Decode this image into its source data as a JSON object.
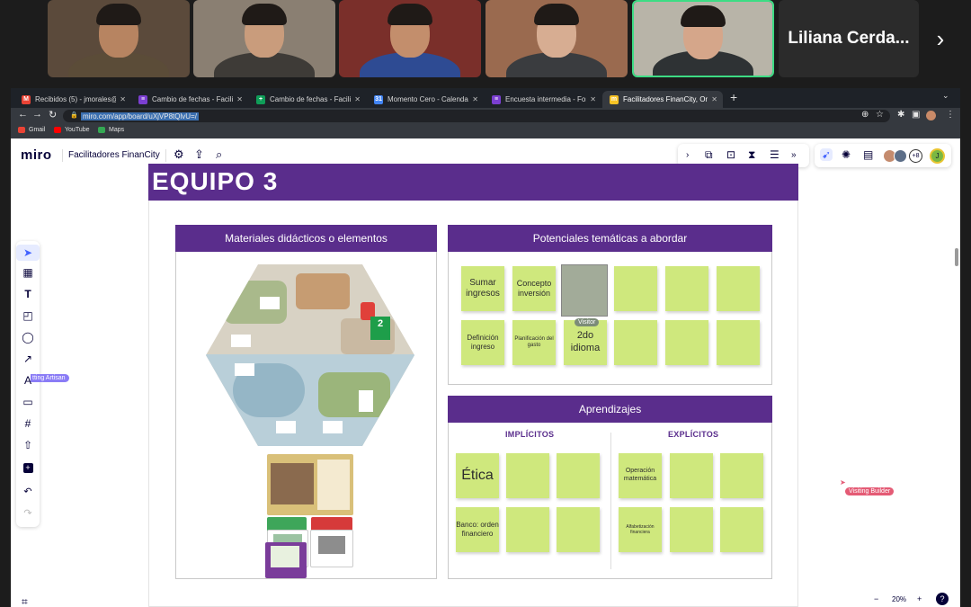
{
  "meeting": {
    "participants": [
      {
        "bg": "#5b4a3b",
        "skin": "#b78461",
        "shirt": "#5b4c38"
      },
      {
        "bg": "#8a7f72",
        "skin": "#c99c7c",
        "shirt": "#3e3b37"
      },
      {
        "bg": "#7a2f2a",
        "skin": "#c38e6c",
        "shirt": "#2e4b93"
      },
      {
        "bg": "#9a6a4f",
        "skin": "#d7ad92",
        "shirt": "#3a3c3f"
      },
      {
        "bg": "#b8b4a8",
        "skin": "#d5a68a",
        "shirt": "#2e3234"
      }
    ],
    "name_tile": "Liliana Cerda..."
  },
  "browser": {
    "tabs": [
      {
        "title": "Recibidos (5) - jmorales@mom",
        "fav": "M",
        "fav_color": "#ea4335"
      },
      {
        "title": "Cambio de fechas - Facilitador",
        "fav": "≡",
        "fav_color": "#7b3fd1"
      },
      {
        "title": "Cambio de fechas - Facilitador",
        "fav": "+",
        "fav_color": "#0f9d58"
      },
      {
        "title": "Momento Cero - Calendar - Se",
        "fav": "31",
        "fav_color": "#4285f4"
      },
      {
        "title": "Encuesta intermedia - Formula",
        "fav": "≡",
        "fav_color": "#7b3fd1"
      },
      {
        "title": "Facilitadores FinanCity, Online",
        "fav": "m",
        "fav_color": "#f7c325"
      }
    ],
    "url": "miro.com/app/board/uXjVP8tQlvU=/",
    "bookmarks": [
      {
        "label": "Gmail",
        "color": "#ea4335"
      },
      {
        "label": "YouTube",
        "color": "#ff0000"
      },
      {
        "label": "Maps",
        "color": "#34a853"
      }
    ]
  },
  "miro": {
    "logo": "miro",
    "board_name": "Facilitadores FinanCity",
    "zoom": "20%",
    "help": "?",
    "collab_count": "+8",
    "frame_title": "EQUIPO 3",
    "panels": {
      "materiales": {
        "title": "Materiales didácticos o elementos"
      },
      "tematicas": {
        "title": "Potenciales temáticas a abordar",
        "notes": [
          "Sumar ingresos",
          "Concepto inversión",
          "Definición ingreso",
          "Planificación del gasto",
          "2do idioma"
        ]
      },
      "aprendizajes": {
        "title": "Aprendizajes",
        "implicitos": "IMPLÍCITOS",
        "explicitos": "EXPLÍCITOS",
        "notes": [
          "Ética",
          "Banco: orden financiero",
          "Operación matemática",
          "Alfabetización financiera"
        ]
      }
    },
    "cursors": {
      "visitor": "Visitor",
      "visiting_artisan": "tting Artisan",
      "visiting_builder": "Visiting Builder"
    },
    "board_tokens": {
      "big_number": "2"
    }
  }
}
